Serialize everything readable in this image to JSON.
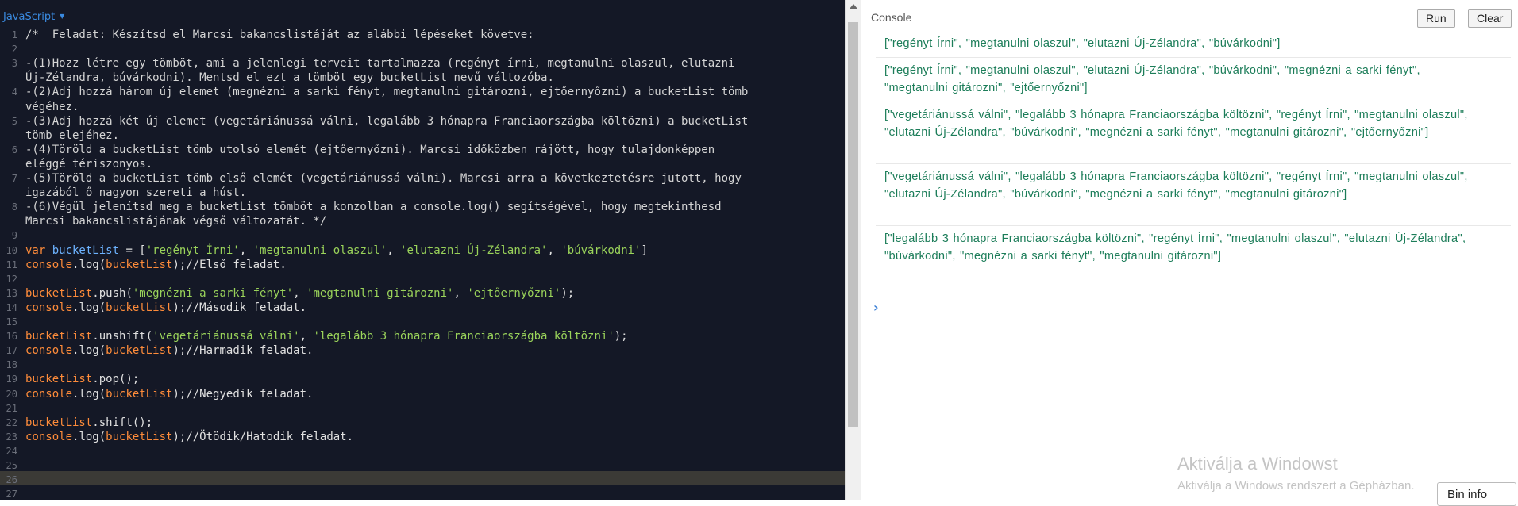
{
  "editor": {
    "language": "JavaScript",
    "lines": [
      {
        "n": "1",
        "parts": [
          {
            "c": "c-comment",
            "t": "/*  Feladat: Készítsd el Marcsi bakancslistáját az alábbi lépéseket követve:"
          }
        ]
      },
      {
        "n": "2",
        "parts": []
      },
      {
        "n": "3",
        "parts": [
          {
            "c": "c-comment",
            "t": "-(1)Hozz létre egy tömböt, ami a jelenlegi terveit tartalmazza (regényt írni, megtanulni olaszul, elutazni"
          }
        ]
      },
      {
        "n": "",
        "parts": [
          {
            "c": "c-comment",
            "t": "Új-Zélandra, búvárkodni). Mentsd el ezt a tömböt egy bucketList nevű változóba."
          }
        ]
      },
      {
        "n": "4",
        "parts": [
          {
            "c": "c-comment",
            "t": "-(2)Adj hozzá három új elemet (megnézni a sarki fényt, megtanulni gitározni, ejtőernyőzni) a bucketList tömb"
          }
        ]
      },
      {
        "n": "",
        "parts": [
          {
            "c": "c-comment",
            "t": "végéhez."
          }
        ]
      },
      {
        "n": "5",
        "parts": [
          {
            "c": "c-comment",
            "t": "-(3)Adj hozzá két új elemet (vegetáriánussá válni, legalább 3 hónapra Franciaországba költözni) a bucketList"
          }
        ]
      },
      {
        "n": "",
        "parts": [
          {
            "c": "c-comment",
            "t": "tömb elejéhez."
          }
        ]
      },
      {
        "n": "6",
        "parts": [
          {
            "c": "c-comment",
            "t": "-(4)Töröld a bucketList tömb utolsó elemét (ejtőernyőzni). Marcsi időközben rájött, hogy tulajdonképpen"
          }
        ]
      },
      {
        "n": "",
        "parts": [
          {
            "c": "c-comment",
            "t": "eléggé tériszonyos."
          }
        ]
      },
      {
        "n": "7",
        "parts": [
          {
            "c": "c-comment",
            "t": "-(5)Töröld a bucketList tömb első elemét (vegetáriánussá válni). Marcsi arra a következtetésre jutott, hogy"
          }
        ]
      },
      {
        "n": "",
        "parts": [
          {
            "c": "c-comment",
            "t": "igazából ő nagyon szereti a húst."
          }
        ]
      },
      {
        "n": "8",
        "parts": [
          {
            "c": "c-comment",
            "t": "-(6)Végül jelenítsd meg a bucketList tömböt a konzolban a console.log() segítségével, hogy megtekinthesd"
          }
        ]
      },
      {
        "n": "",
        "parts": [
          {
            "c": "c-comment",
            "t": "Marcsi bakancslistájának végső változatát. */"
          }
        ]
      },
      {
        "n": "9",
        "parts": []
      },
      {
        "n": "10",
        "parts": [
          {
            "c": "c-kw",
            "t": "var "
          },
          {
            "c": "c-var",
            "t": "bucketList"
          },
          {
            "c": "c-punc",
            "t": " = ["
          },
          {
            "c": "c-str",
            "t": "'regényt Írni'"
          },
          {
            "c": "c-punc",
            "t": ", "
          },
          {
            "c": "c-str",
            "t": "'megtanulni olaszul'"
          },
          {
            "c": "c-punc",
            "t": ", "
          },
          {
            "c": "c-str",
            "t": "'elutazni Új-Zélandra'"
          },
          {
            "c": "c-punc",
            "t": ", "
          },
          {
            "c": "c-str",
            "t": "'búvárkodni'"
          },
          {
            "c": "c-punc",
            "t": "]"
          }
        ]
      },
      {
        "n": "11",
        "parts": [
          {
            "c": "c-obj",
            "t": "console"
          },
          {
            "c": "c-punc",
            "t": ".log("
          },
          {
            "c": "c-obj",
            "t": "bucketList"
          },
          {
            "c": "c-punc",
            "t": ");//Első feladat."
          }
        ]
      },
      {
        "n": "12",
        "parts": []
      },
      {
        "n": "13",
        "parts": [
          {
            "c": "c-obj",
            "t": "bucketList"
          },
          {
            "c": "c-punc",
            "t": ".push("
          },
          {
            "c": "c-str",
            "t": "'megnézni a sarki fényt'"
          },
          {
            "c": "c-punc",
            "t": ", "
          },
          {
            "c": "c-str",
            "t": "'megtanulni gitározni'"
          },
          {
            "c": "c-punc",
            "t": ", "
          },
          {
            "c": "c-str",
            "t": "'ejtőernyőzni'"
          },
          {
            "c": "c-punc",
            "t": ");"
          }
        ]
      },
      {
        "n": "14",
        "parts": [
          {
            "c": "c-obj",
            "t": "console"
          },
          {
            "c": "c-punc",
            "t": ".log("
          },
          {
            "c": "c-obj",
            "t": "bucketList"
          },
          {
            "c": "c-punc",
            "t": ");//Második feladat."
          }
        ]
      },
      {
        "n": "15",
        "parts": []
      },
      {
        "n": "16",
        "parts": [
          {
            "c": "c-obj",
            "t": "bucketList"
          },
          {
            "c": "c-punc",
            "t": ".unshift("
          },
          {
            "c": "c-str",
            "t": "'vegetáriánussá válni'"
          },
          {
            "c": "c-punc",
            "t": ", "
          },
          {
            "c": "c-str",
            "t": "'legalább 3 hónapra Franciaországba költözni'"
          },
          {
            "c": "c-punc",
            "t": ");"
          }
        ]
      },
      {
        "n": "17",
        "parts": [
          {
            "c": "c-obj",
            "t": "console"
          },
          {
            "c": "c-punc",
            "t": ".log("
          },
          {
            "c": "c-obj",
            "t": "bucketList"
          },
          {
            "c": "c-punc",
            "t": ");//Harmadik feladat."
          }
        ]
      },
      {
        "n": "18",
        "parts": []
      },
      {
        "n": "19",
        "parts": [
          {
            "c": "c-obj",
            "t": "bucketList"
          },
          {
            "c": "c-punc",
            "t": ".pop();"
          }
        ]
      },
      {
        "n": "20",
        "parts": [
          {
            "c": "c-obj",
            "t": "console"
          },
          {
            "c": "c-punc",
            "t": ".log("
          },
          {
            "c": "c-obj",
            "t": "bucketList"
          },
          {
            "c": "c-punc",
            "t": ");//Negyedik feladat."
          }
        ]
      },
      {
        "n": "21",
        "parts": []
      },
      {
        "n": "22",
        "parts": [
          {
            "c": "c-obj",
            "t": "bucketList"
          },
          {
            "c": "c-punc",
            "t": ".shift();"
          }
        ]
      },
      {
        "n": "23",
        "parts": [
          {
            "c": "c-obj",
            "t": "console"
          },
          {
            "c": "c-punc",
            "t": ".log("
          },
          {
            "c": "c-obj",
            "t": "bucketList"
          },
          {
            "c": "c-punc",
            "t": ");//Ötödik/Hatodik feladat."
          }
        ]
      },
      {
        "n": "24",
        "parts": []
      },
      {
        "n": "25",
        "parts": []
      },
      {
        "n": "26",
        "parts": []
      },
      {
        "n": "27",
        "parts": []
      }
    ]
  },
  "console": {
    "title": "Console",
    "run_label": "Run",
    "clear_label": "Clear",
    "prompt_symbol": "›",
    "outputs": [
      "[\"regényt Írni\", \"megtanulni olaszul\", \"elutazni Új-Zélandra\", \"búvárkodni\"]",
      "[\"regényt Írni\", \"megtanulni olaszul\", \"elutazni Új-Zélandra\", \"búvárkodni\", \"megnézni a sarki fényt\", \"megtanulni gitározni\", \"ejtőernyőzni\"]",
      "[\"vegetáriánussá válni\", \"legalább 3 hónapra Franciaországba költözni\", \"regényt Írni\", \"megtanulni olaszul\", \"elutazni Új-Zélandra\", \"búvárkodni\", \"megnézni a sarki fényt\", \"megtanulni gitározni\", \"ejtőernyőzni\"]",
      "[\"vegetáriánussá válni\", \"legalább 3 hónapra Franciaországba költözni\", \"regényt Írni\", \"megtanulni olaszul\", \"elutazni Új-Zélandra\", \"búvárkodni\", \"megnézni a sarki fényt\", \"megtanulni gitározni\"]",
      "[\"legalább 3 hónapra Franciaországba költözni\", \"regényt Írni\", \"megtanulni olaszul\", \"elutazni Új-Zélandra\", \"búvárkodni\", \"megnézni a sarki fényt\", \"megtanulni gitározni\"]"
    ]
  },
  "watermark": {
    "line1": "Aktiválja a Windowst",
    "line2": "Aktiválja a Windows rendszert a Gépházban."
  },
  "bin_info_label": "Bin info",
  "colors": {
    "editor_bg": "#141826",
    "keyword": "#ff8c3a",
    "variable": "#6db3ff",
    "string": "#9ad35a",
    "console_output": "#1c7d59"
  }
}
